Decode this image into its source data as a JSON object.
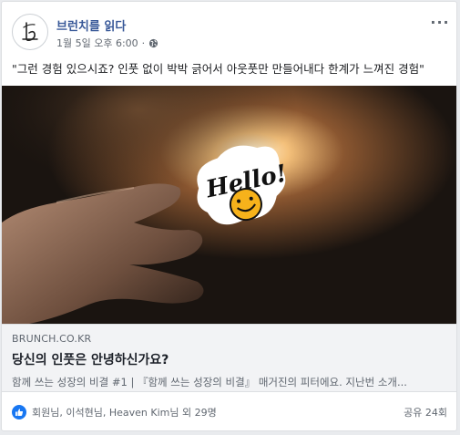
{
  "header": {
    "page_name": "브런치를 읽다",
    "timestamp": "1월 5일 오후 6:00",
    "separator": "·",
    "more_label": "···"
  },
  "post": {
    "text": "\"그런 경험 있으시죠? 인풋 없이 박박 긁어서 아웃풋만 만들어내다 한계가 느껴진 경험\""
  },
  "image": {
    "sticker_text": "Hello!"
  },
  "link": {
    "domain": "BRUNCH.CO.KR",
    "title": "당신의 인풋은 안녕하신가요?",
    "description": "함께 쓰는 성장의 비결 #1 | 『함께 쓰는 성장의 비결』 매거진의 피터에요. 지난번 소개..."
  },
  "footer": {
    "reactions_text": "회원님, 이석현님, Heaven Kim님 외 29명",
    "shares_text": "공유 24회"
  },
  "colors": {
    "link_blue": "#385898",
    "like_blue": "#1877f2",
    "secondary_text": "#606770"
  },
  "icons": {
    "avatar": "brunch-b-logo",
    "privacy": "globe-icon",
    "more": "more-dots-icon",
    "like": "thumbs-up-icon"
  }
}
